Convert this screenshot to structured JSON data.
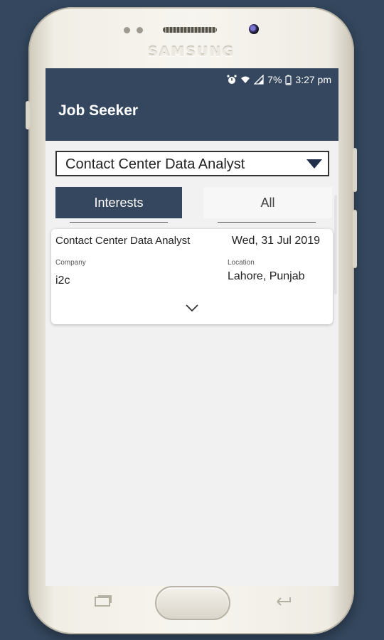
{
  "device": {
    "brand": "SAMSUNG"
  },
  "status_bar": {
    "battery": "7%",
    "time": "3:27 pm",
    "icons": [
      "alarm-icon",
      "wifi-icon",
      "signal-icon",
      "battery-icon"
    ]
  },
  "app_bar": {
    "title": "Job Seeker"
  },
  "category_select": {
    "selected": "Contact Center Data Analyst"
  },
  "tabs": [
    {
      "label": "Interests",
      "active": true
    },
    {
      "label": "All",
      "active": false
    }
  ],
  "job_card": {
    "title": "Contact Center Data Analyst",
    "date": "Wed, 31 Jul 2019",
    "company_label": "Company",
    "company": "i2c",
    "location_label": "Location",
    "location": "Lahore, Punjab"
  },
  "colors": {
    "primary": "#34475e",
    "background": "#34475e",
    "card": "#ffffff"
  }
}
